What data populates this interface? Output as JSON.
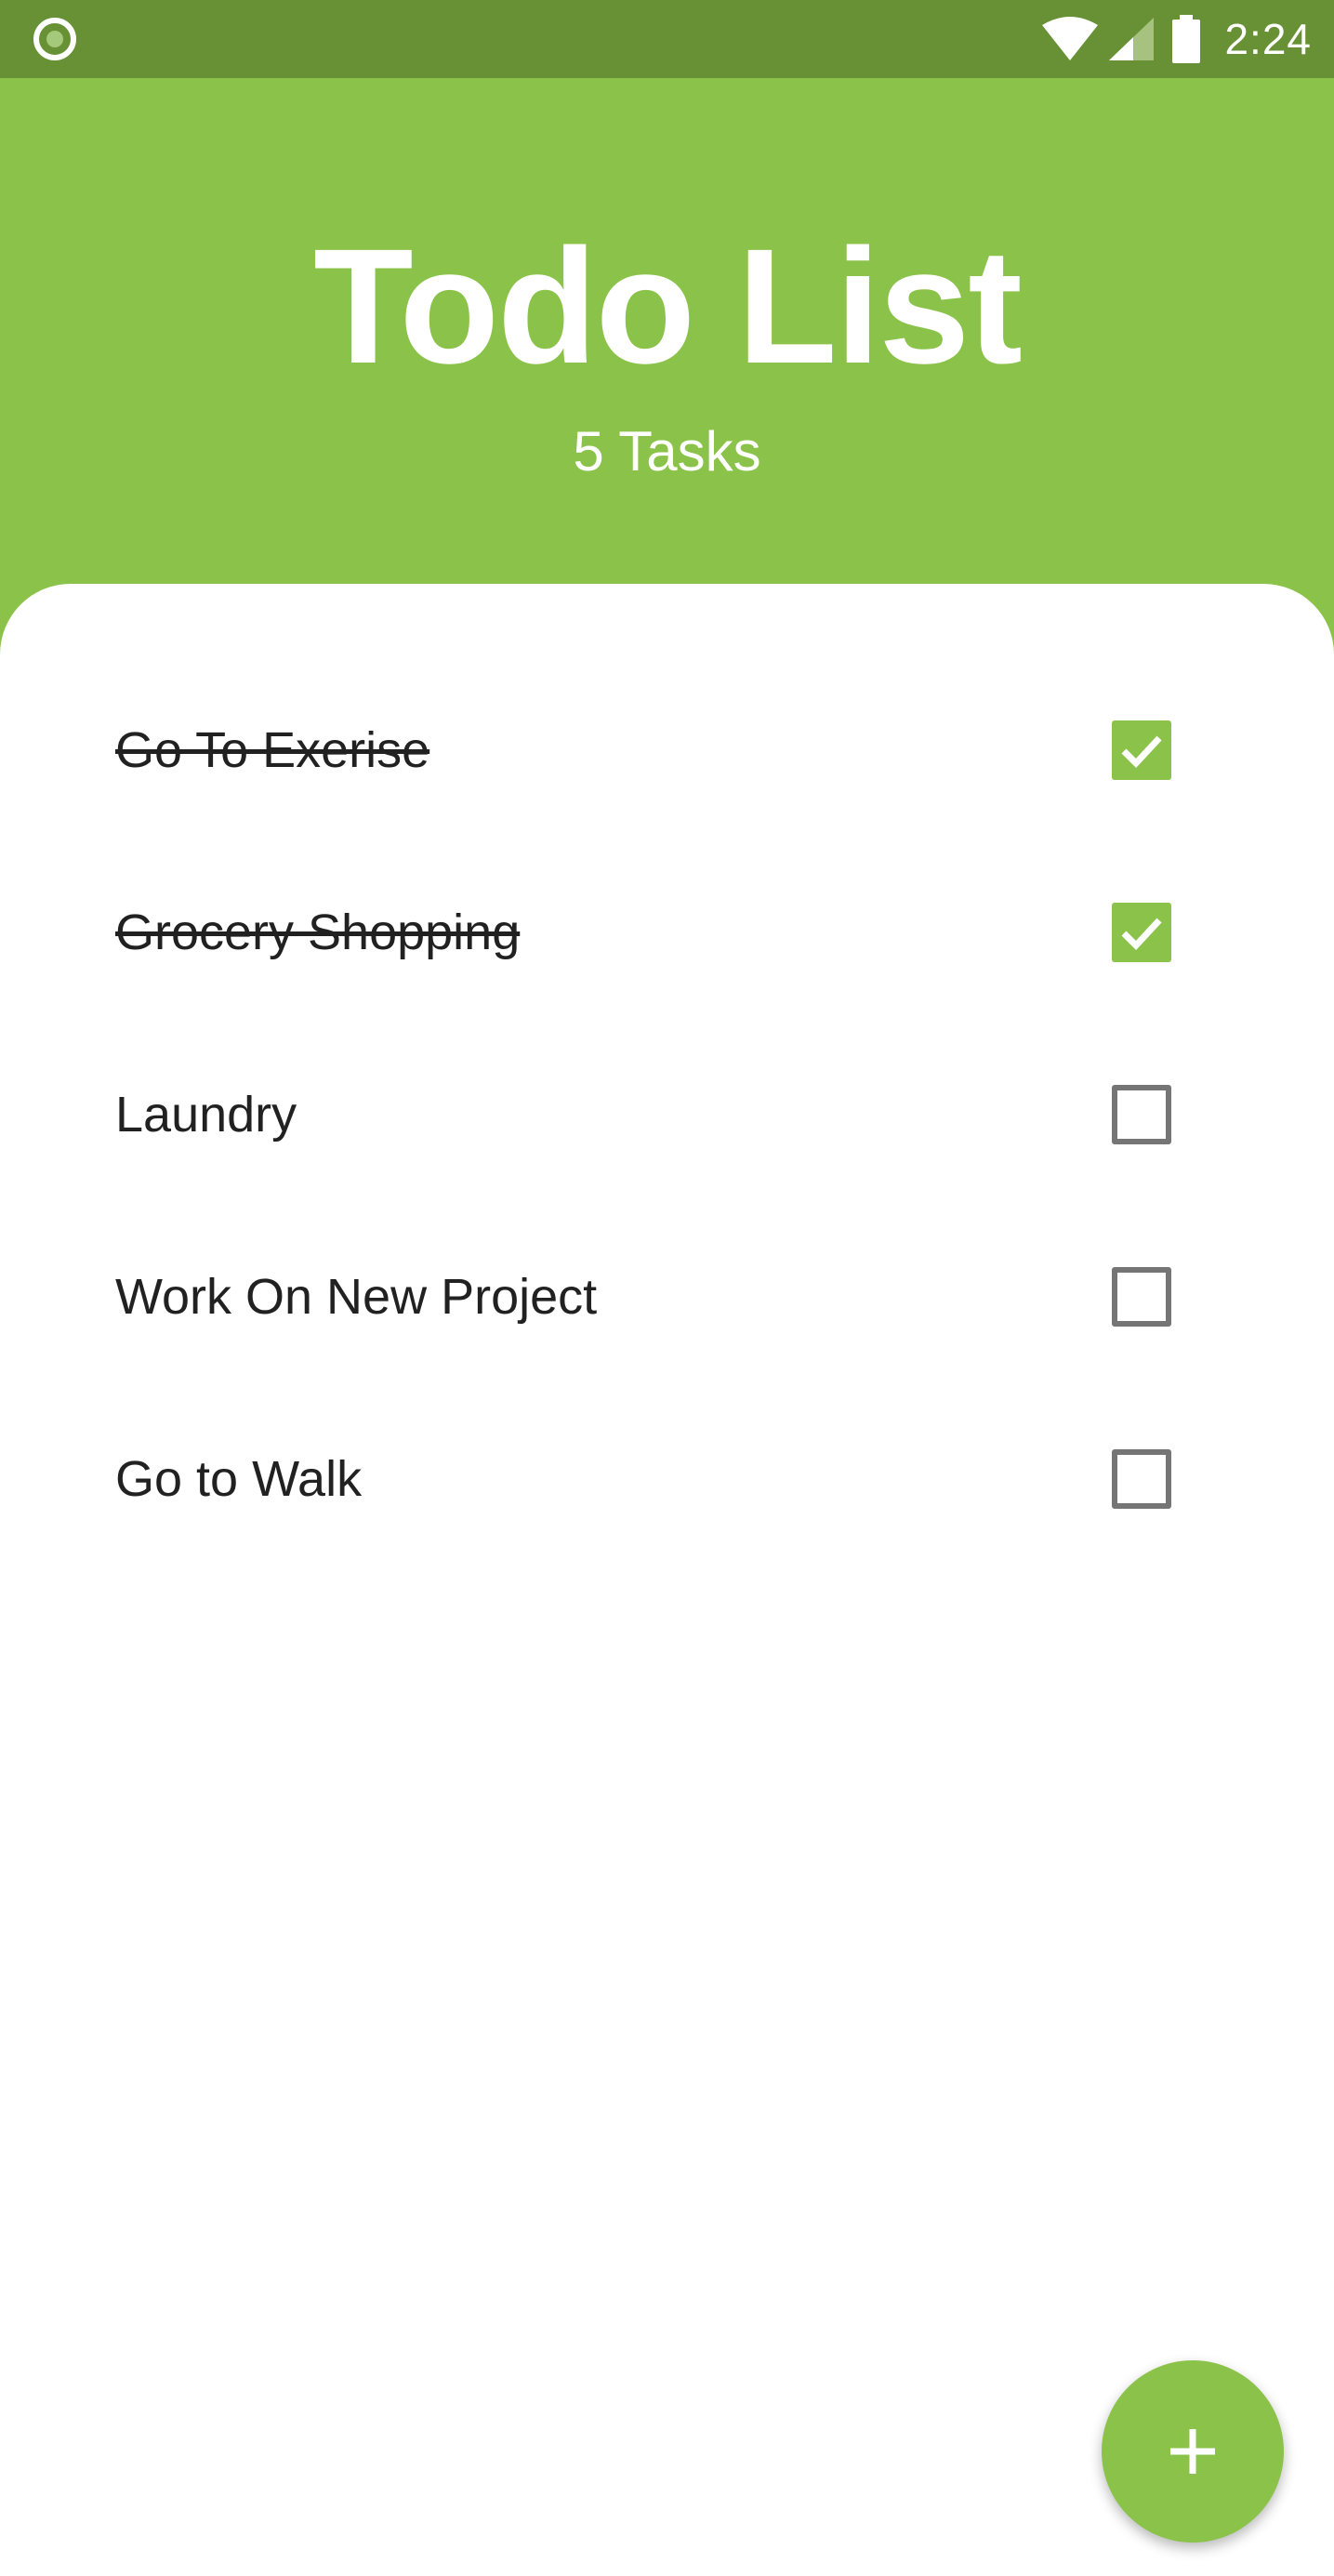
{
  "status_bar": {
    "time": "2:24",
    "icons": [
      "notification-circle-icon",
      "wifi-icon",
      "cell-signal-icon",
      "battery-icon"
    ]
  },
  "header": {
    "title": "Todo List",
    "subtitle": "5 Tasks"
  },
  "tasks": [
    {
      "label": "Go To Exerise",
      "checked": true
    },
    {
      "label": "Grocery Shopping",
      "checked": true
    },
    {
      "label": "Laundry",
      "checked": false
    },
    {
      "label": "Work On New Project",
      "checked": false
    },
    {
      "label": "Go to Walk",
      "checked": false
    }
  ],
  "fab": {
    "icon": "plus-icon"
  },
  "colors": {
    "accent": "#8bc34a",
    "status_bar": "#689136",
    "text": "#212121",
    "unchecked_border": "#757575"
  }
}
